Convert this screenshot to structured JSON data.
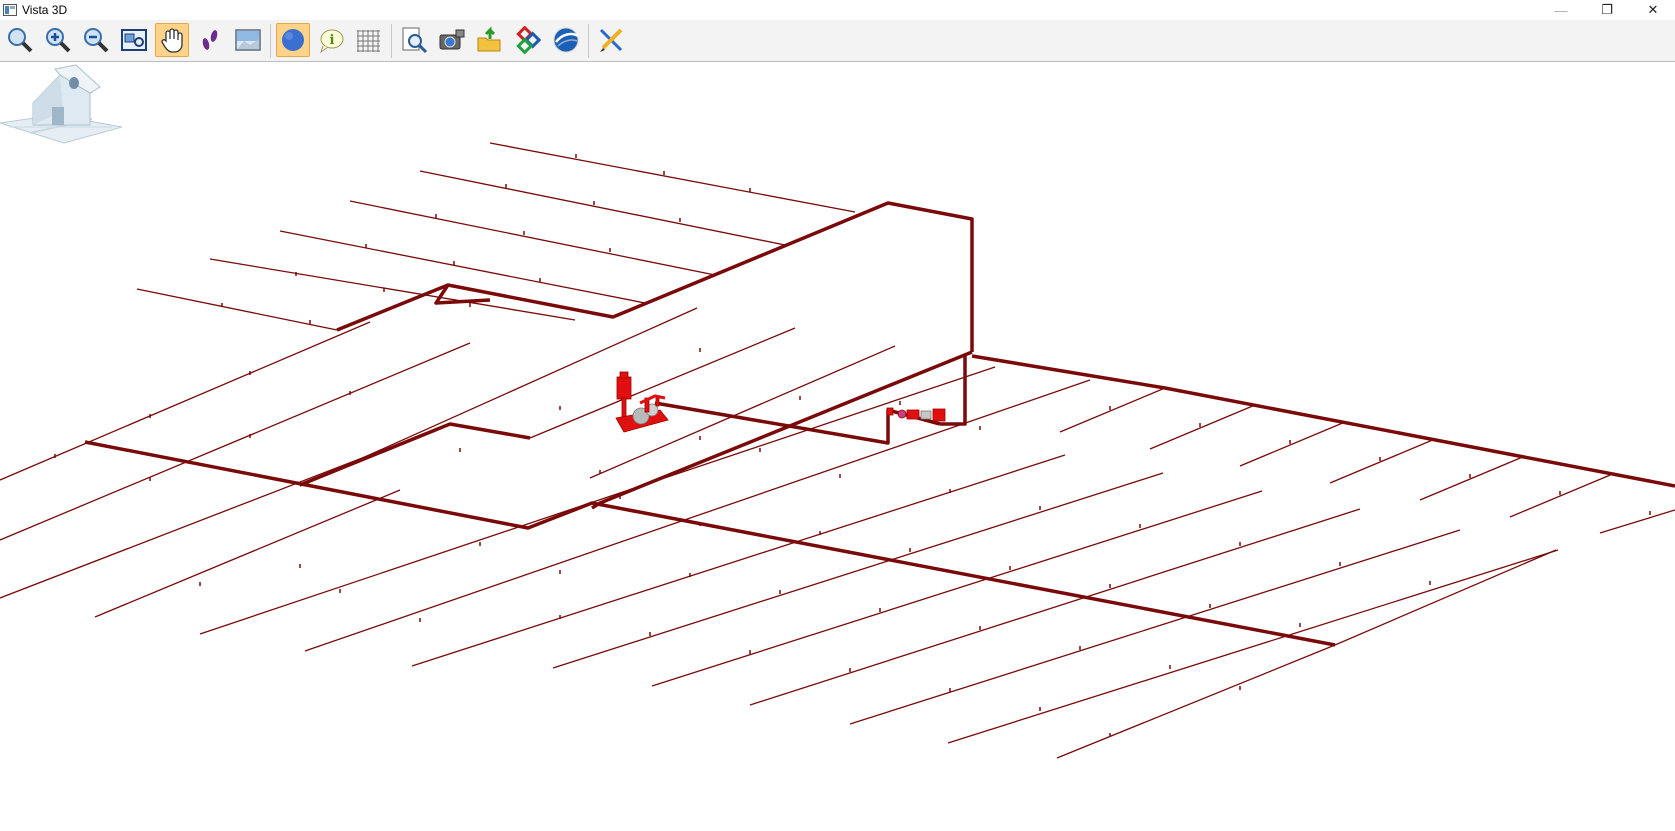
{
  "window": {
    "title": "Vista 3D",
    "minimize_glyph": "—",
    "restore_glyph": "❐",
    "close_glyph": "✕"
  },
  "toolbar": {
    "buttons": [
      {
        "name": "zoom-extents-icon",
        "active": false
      },
      {
        "name": "zoom-in-icon",
        "active": false
      },
      {
        "name": "zoom-out-icon",
        "active": false
      },
      {
        "name": "zoom-window-icon",
        "active": false
      },
      {
        "name": "pan-hand-icon",
        "active": true
      },
      {
        "name": "walk-footprints-icon",
        "active": false
      },
      {
        "name": "background-image-icon",
        "active": false
      },
      {
        "name": "shaded-sphere-icon",
        "active": true
      },
      {
        "name": "info-icon",
        "active": false
      },
      {
        "name": "grid-icon",
        "active": false
      },
      {
        "name": "preview-magnifier-icon",
        "active": false
      },
      {
        "name": "camera-icon",
        "active": false
      },
      {
        "name": "export-folder-icon",
        "active": false
      },
      {
        "name": "ifc-export-icon",
        "active": false
      },
      {
        "name": "google-earth-icon",
        "active": false
      },
      {
        "name": "tools-pencil-icon",
        "active": false
      }
    ]
  },
  "scene": {
    "pipe_color": "#7a0a0a",
    "equipment_color": "#e01010",
    "view_cube": "home-view-cube-icon"
  }
}
